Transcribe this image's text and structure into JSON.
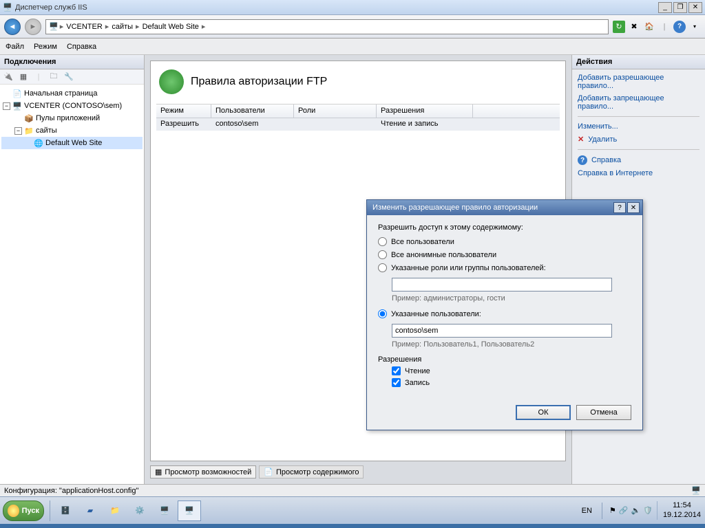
{
  "window": {
    "title": "Диспетчер служб IIS",
    "minimize": "_",
    "restore": "❐",
    "close": "✕"
  },
  "breadcrumb": {
    "items": [
      "VCENTER",
      "сайты",
      "Default Web Site"
    ],
    "refresh_green": "↻"
  },
  "menu": {
    "file": "Файл",
    "mode": "Режим",
    "help": "Справка"
  },
  "left": {
    "title": "Подключения",
    "tree": {
      "start_page": "Начальная страница",
      "server": "VCENTER (CONTOSO\\sem)",
      "app_pools": "Пулы приложений",
      "sites": "сайты",
      "default_site": "Default Web Site"
    }
  },
  "center": {
    "heading": "Правила авторизации FTP",
    "columns": {
      "mode": "Режим",
      "users": "Пользователи",
      "roles": "Роли",
      "perms": "Разрешения"
    },
    "row": {
      "mode": "Разрешить",
      "users": "contoso\\sem",
      "roles": "",
      "perms": "Чтение и запись"
    },
    "tabs": {
      "features": "Просмотр возможностей",
      "content": "Просмотр содержимого"
    }
  },
  "right": {
    "title": "Действия",
    "add_allow": "Добавить разрешающее правило...",
    "add_deny": "Добавить запрещающее правило...",
    "edit": "Изменить...",
    "delete": "Удалить",
    "help": "Справка",
    "online_help": "Справка в Интернете"
  },
  "dialog": {
    "title": "Изменить разрешающее правило авторизации",
    "help_btn": "?",
    "close_btn": "✕",
    "intro": "Разрешить доступ к этому содержимому:",
    "opt_all_users": "Все пользователи",
    "opt_all_anon": "Все анонимные пользователи",
    "opt_roles": "Указанные роли или группы пользователей:",
    "roles_value": "",
    "roles_hint": "Пример: администраторы, гости",
    "opt_users": "Указанные пользователи:",
    "users_value": "contoso\\sem",
    "users_hint": "Пример: Пользователь1, Пользователь2",
    "perms_label": "Разрешения",
    "perm_read": "Чтение",
    "perm_write": "Запись",
    "ok": "ОК",
    "cancel": "Отмена"
  },
  "status": {
    "text": "Конфигурация: \"applicationHost.config\""
  },
  "taskbar": {
    "start": "Пуск",
    "lang": "EN",
    "time": "11:54",
    "date": "19.12.2014"
  }
}
